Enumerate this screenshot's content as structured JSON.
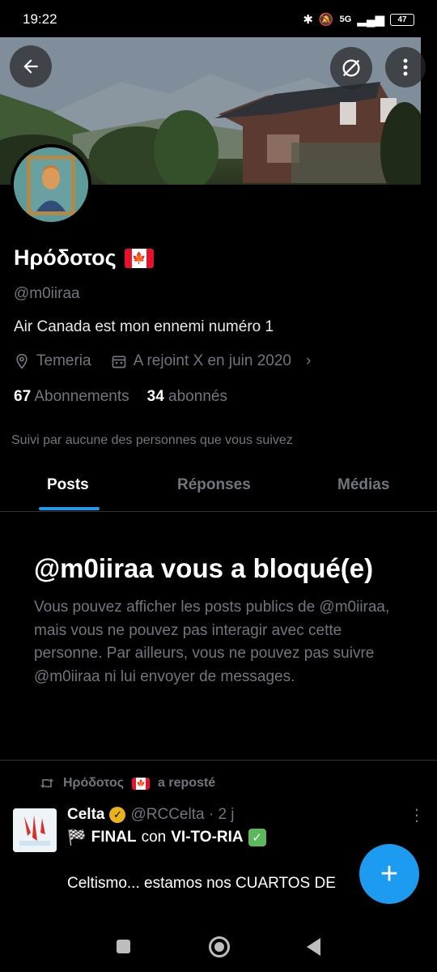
{
  "status_bar": {
    "time": "19:22",
    "network": "5G",
    "battery": "47",
    "icons": [
      "bluetooth-icon",
      "mute-icon",
      "signal-icon",
      "battery-icon"
    ]
  },
  "profile": {
    "display_name": "Ηρόδοτος",
    "handle": "@m0iiraa",
    "bio": "Air Canada est mon ennemi numéro 1",
    "location": "Temeria",
    "joined": "A rejoint X en juin 2020",
    "following_count": "67",
    "following_label": "Abonnements",
    "followers_count": "34",
    "followers_label": "abonnés",
    "followed_by": "Suivi par aucune des personnes que vous suivez"
  },
  "tabs": [
    {
      "label": "Posts",
      "active": true
    },
    {
      "label": "Réponses",
      "active": false
    },
    {
      "label": "Médias",
      "active": false
    }
  ],
  "blocked": {
    "title": "@m0iiraa vous a bloqué(e)",
    "message": "Vous pouvez afficher les posts publics de @m0iiraa, mais vous ne pouvez pas interagir avec cette personne. Par ailleurs, vous ne pouvez pas suivre @m0iiraa ni lui envoyer de messages."
  },
  "post": {
    "repost_name": "Ηρόδοτος",
    "repost_label": "a reposté",
    "author": "Celta",
    "handle_time": "@RCCelta · 2 j",
    "line1_final": "FINAL",
    "line1_con": "con",
    "line1_victory": "VI-TO-RIA",
    "line2": "Celtismo... estamos nos CUARTOS DE",
    "line2_tail": "!"
  },
  "colors": {
    "accent": "#1d9bf0",
    "muted": "#71767b",
    "background": "#000000",
    "verified": "#e8b21c"
  }
}
